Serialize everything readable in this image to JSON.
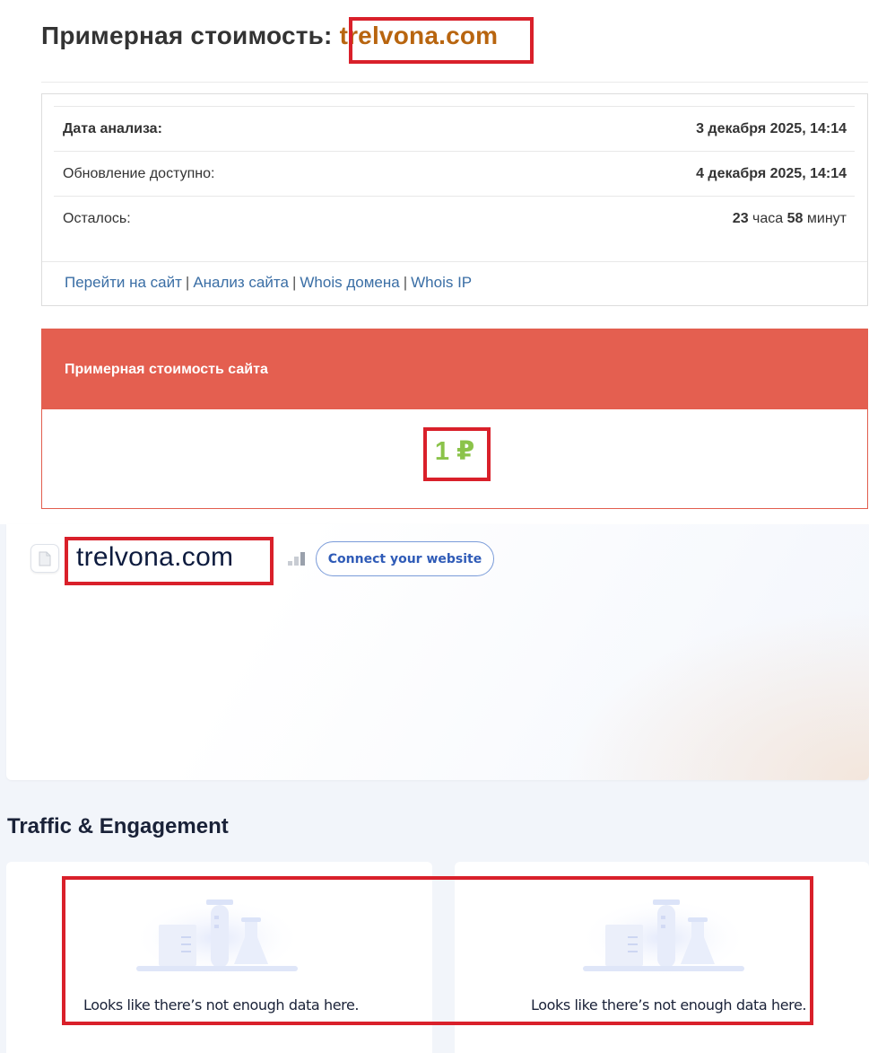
{
  "header": {
    "title_prefix": "Примерная стоимость:",
    "domain": "trelvona.com"
  },
  "analysis": {
    "date_label": "Дата анализа:",
    "date_value": "3 декабря 2025, 14:14",
    "update_label": "Обновление доступно:",
    "update_value": "4 декабря 2025, 14:14",
    "remaining_label": "Осталось:",
    "remaining_hours": "23",
    "remaining_hours_unit": "часа",
    "remaining_minutes": "58",
    "remaining_minutes_unit": "минут"
  },
  "links": {
    "visit": "Перейти на сайт",
    "analysis": "Анализ сайта",
    "whois_domain": "Whois домена",
    "whois_ip": "Whois IP",
    "separator": "|"
  },
  "price": {
    "header": "Примерная стоимость сайта",
    "value": "1 ₽"
  },
  "site_card": {
    "domain": "trelvona.com",
    "connect_button": "Connect your website"
  },
  "traffic": {
    "title": "Traffic & Engagement",
    "cards": [
      {
        "message": "Looks like there’s not enough data here."
      },
      {
        "message": "Looks like there’s not enough data here."
      }
    ]
  },
  "colors": {
    "domain_title": "#b8650f",
    "price_header_bg": "#e45f50",
    "price_value": "#8bc34a",
    "highlight_border": "#d9202a",
    "link": "#3a6ea5"
  },
  "icons": {
    "favicon": "document-icon",
    "signal": "signal-bars-icon",
    "illustration": "lab-flasks-illustration-icon"
  }
}
